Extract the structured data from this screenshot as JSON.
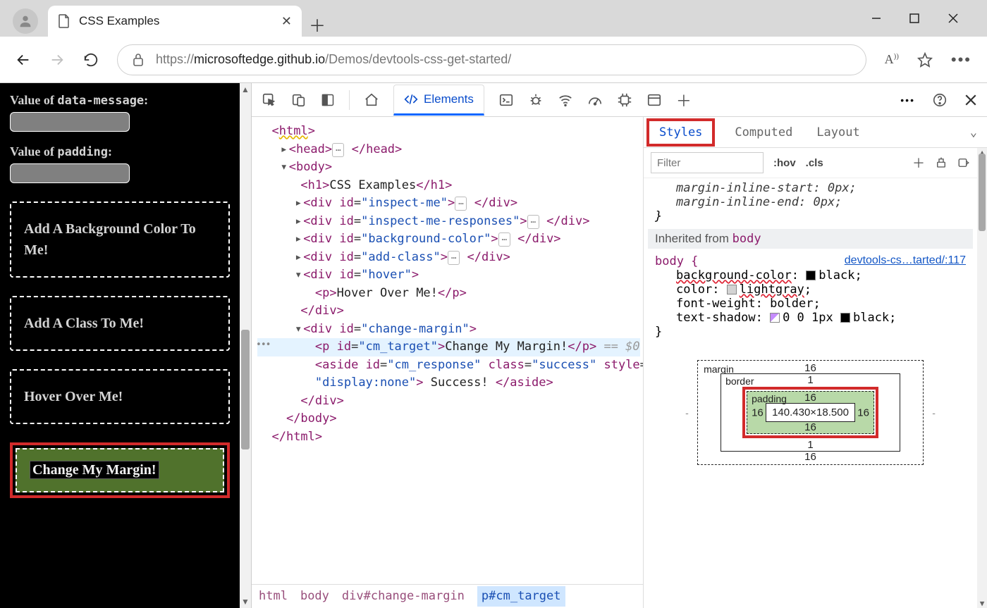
{
  "window": {
    "tab_title": "CSS Examples"
  },
  "toolbar": {
    "url_host": "microsoftedge.github.io",
    "url_scheme": "https://",
    "url_path": "/Demos/devtools-css-get-started/"
  },
  "page": {
    "label_data_message_prefix": "Value of ",
    "label_data_message_mono": "data-message",
    "label_data_message_suffix": ":",
    "label_padding_prefix": "Value of ",
    "label_padding_mono": "padding",
    "label_padding_suffix": ":",
    "box_bg": "Add A Background Color To Me!",
    "box_class": "Add A Class To Me!",
    "box_hover": "Hover Over Me!",
    "box_margin": "Change My Margin!"
  },
  "devtools": {
    "elements_tab": "Elements",
    "breadcrumbs": [
      "html",
      "body",
      "div#change-margin",
      "p#cm_target"
    ]
  },
  "dom": {
    "l_html_open": "<html>",
    "l_head": "<head>",
    "l_head_close": "</head>",
    "l_body": "<body>",
    "l_h1_open": "<h1>",
    "l_h1_text": "CSS Examples",
    "l_h1_close": "</h1>",
    "l_div_inspect": "inspect-me",
    "l_div_inspect_r": "inspect-me-responses",
    "l_div_bg": "background-color",
    "l_div_addclass": "add-class",
    "l_div_hover": "hover",
    "l_p_hover_text": "Hover Over Me!",
    "l_div_changemargin": "change-margin",
    "l_p_cm_id": "cm_target",
    "l_p_cm_text": "Change My Margin!",
    "l_cm_eq": "== $0",
    "l_aside_id": "cm_response",
    "l_aside_class": "success",
    "l_aside_style": "display:none",
    "l_aside_text": " Success! "
  },
  "styles": {
    "tabs": {
      "styles": "Styles",
      "computed": "Computed",
      "layout": "Layout"
    },
    "filter_placeholder": "Filter",
    "hov": ":hov",
    "cls": ".cls",
    "r1_p1": "margin-inline-start: 0px;",
    "r1_p2": "margin-inline-end: 0px;",
    "inherited_label": "Inherited from ",
    "inherited_sel": "body",
    "body_sel": "body {",
    "body_link": "devtools-cs…tarted/:117",
    "p_bg_n": "background-color",
    "p_bg_v": "black",
    "p_color_n": "color",
    "p_color_v": "lightgray",
    "p_fw_n": "font-weight",
    "p_fw_v": "bolder",
    "p_ts_n": "text-shadow",
    "p_ts_v1": "0 0 1px",
    "p_ts_v2": "black"
  },
  "boxmodel": {
    "margin_label": "margin",
    "border_label": "border",
    "padding_label": "padding",
    "margin": "16",
    "border": "1",
    "padding": "16",
    "content": "140.430×18.500"
  }
}
